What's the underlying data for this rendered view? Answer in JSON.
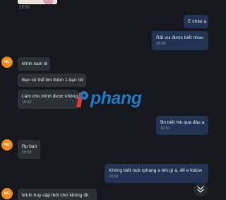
{
  "header_time": "15:50",
  "watermark": {
    "text": "phang"
  },
  "messages": [
    {
      "direction": "out",
      "text": "E chào ạ",
      "time": ""
    },
    {
      "direction": "out",
      "text": "Rất vui được biết nhau",
      "time": "15:50"
    },
    {
      "direction": "in",
      "avatar": "NC",
      "text": "Mình nam lê",
      "time": ""
    },
    {
      "direction": "in",
      "text": "Bạn có thể tìm thêm 1 bạn nữ",
      "time": ""
    },
    {
      "direction": "in",
      "text": "Làm cho mình được không",
      "time": "15:52"
    },
    {
      "direction": "out",
      "text": "Bn biết mk qua đâu ạ",
      "time": "15:52"
    },
    {
      "direction": "in",
      "avatar": "NC",
      "text": "Rp bạn",
      "time": "15:52"
    },
    {
      "direction": "out",
      "text": "Không biết nick rphang a tên gì ạ, để e follow",
      "time": "15:53"
    },
    {
      "direction": "in",
      "avatar": "NC",
      "text": "Mình truy cập thôi chứ không đk",
      "time": ""
    }
  ],
  "icons": {
    "scroll_down": "double-chevron-down-icon"
  }
}
